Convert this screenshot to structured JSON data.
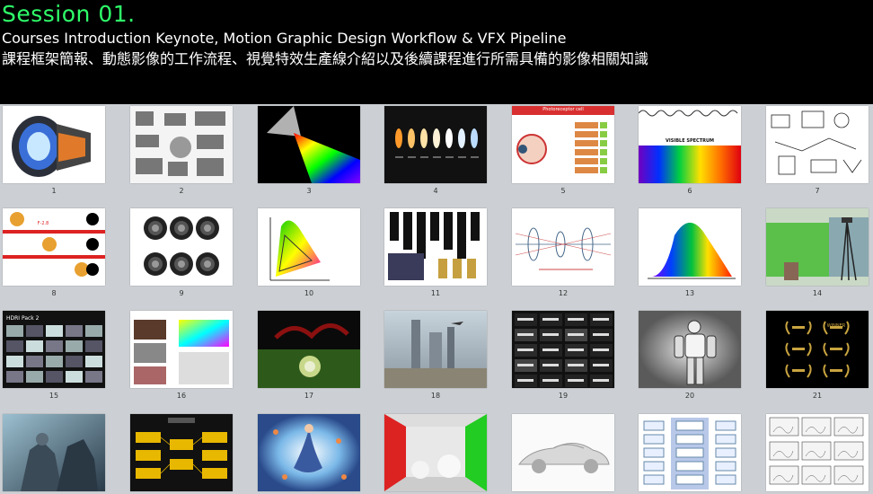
{
  "header": {
    "title": "Session 01.",
    "subtitle_en": "Courses Introduction Keynote, Motion Graphic Design Workflow & VFX Pipeline",
    "subtitle_zh": "課程框架簡報、動態影像的工作流程、視覺特效生產線介紹以及後續課程進行所需具備的影像相關知識"
  },
  "colors": {
    "title": "#2fff6a",
    "header_bg": "#000000",
    "canvas_bg": "#ccd0d4"
  },
  "slides": [
    {
      "number": "1",
      "icon": "camera-lens-cutaway"
    },
    {
      "number": "2",
      "icon": "lens-diagram-sheet"
    },
    {
      "number": "3",
      "icon": "prism-rainbow"
    },
    {
      "number": "4",
      "icon": "color-temperature-bulbs"
    },
    {
      "number": "5",
      "icon": "eye-photoreceptor",
      "text": "Photoreceptor cell"
    },
    {
      "number": "6",
      "icon": "visible-spectrum",
      "text": "VISIBLE SPECTRUM"
    },
    {
      "number": "7",
      "icon": "sketch-diagram"
    },
    {
      "number": "8",
      "icon": "aperture-depth-of-field",
      "text": "F-2.8"
    },
    {
      "number": "9",
      "icon": "lens-front-elements"
    },
    {
      "number": "10",
      "icon": "cie-chromaticity"
    },
    {
      "number": "11",
      "icon": "film-formats"
    },
    {
      "number": "12",
      "icon": "optical-path-diagram"
    },
    {
      "number": "13",
      "icon": "spectral-distribution"
    },
    {
      "number": "14",
      "icon": "green-screen-studio"
    },
    {
      "number": "15",
      "icon": "hdri-pack",
      "text": "HDRI Pack 2"
    },
    {
      "number": "16",
      "icon": "render-passes"
    },
    {
      "number": "17",
      "icon": "liquid-splash"
    },
    {
      "number": "18",
      "icon": "futuristic-city"
    },
    {
      "number": "19",
      "icon": "movie-title-collage"
    },
    {
      "number": "20",
      "icon": "robot-render"
    },
    {
      "number": "21",
      "icon": "award-laurels",
      "text": "WINNER"
    },
    {
      "number": "",
      "icon": "knight-concept-art"
    },
    {
      "number": "",
      "icon": "node-flowchart"
    },
    {
      "number": "",
      "icon": "fantasy-dancer"
    },
    {
      "number": "",
      "icon": "cornell-box"
    },
    {
      "number": "",
      "icon": "clay-car-render"
    },
    {
      "number": "",
      "icon": "pipeline-chart"
    },
    {
      "number": "",
      "icon": "storyboard"
    }
  ]
}
